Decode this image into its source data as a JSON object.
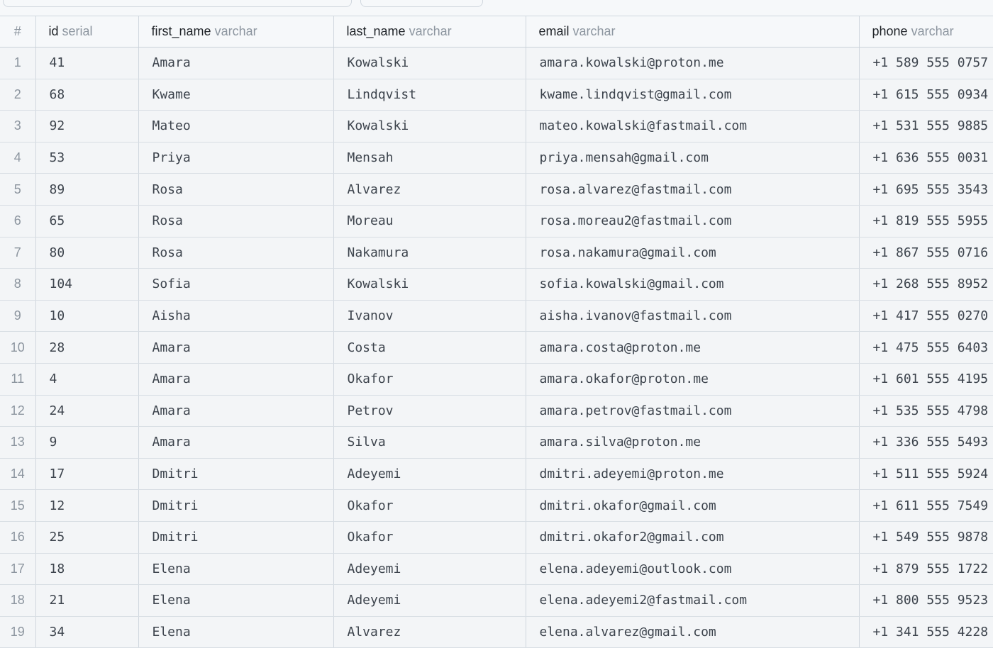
{
  "columns": [
    {
      "name": "id",
      "type": "serial"
    },
    {
      "name": "first_name",
      "type": "varchar"
    },
    {
      "name": "last_name",
      "type": "varchar"
    },
    {
      "name": "email",
      "type": "varchar"
    },
    {
      "name": "phone",
      "type": "varchar"
    }
  ],
  "rownum_header": "#",
  "rows": [
    {
      "n": "1",
      "cells": [
        "41",
        "Amara",
        "Kowalski",
        "amara.kowalski@proton.me",
        "+1 589 555 0757"
      ]
    },
    {
      "n": "2",
      "cells": [
        "68",
        "Kwame",
        "Lindqvist",
        "kwame.lindqvist@gmail.com",
        "+1 615 555 0934"
      ]
    },
    {
      "n": "3",
      "cells": [
        "92",
        "Mateo",
        "Kowalski",
        "mateo.kowalski@fastmail.com",
        "+1 531 555 9885"
      ]
    },
    {
      "n": "4",
      "cells": [
        "53",
        "Priya",
        "Mensah",
        "priya.mensah@gmail.com",
        "+1 636 555 0031"
      ]
    },
    {
      "n": "5",
      "cells": [
        "89",
        "Rosa",
        "Alvarez",
        "rosa.alvarez@fastmail.com",
        "+1 695 555 3543"
      ]
    },
    {
      "n": "6",
      "cells": [
        "65",
        "Rosa",
        "Moreau",
        "rosa.moreau2@fastmail.com",
        "+1 819 555 5955"
      ]
    },
    {
      "n": "7",
      "cells": [
        "80",
        "Rosa",
        "Nakamura",
        "rosa.nakamura@gmail.com",
        "+1 867 555 0716"
      ]
    },
    {
      "n": "8",
      "cells": [
        "104",
        "Sofia",
        "Kowalski",
        "sofia.kowalski@gmail.com",
        "+1 268 555 8952"
      ]
    },
    {
      "n": "9",
      "cells": [
        "10",
        "Aisha",
        "Ivanov",
        "aisha.ivanov@fastmail.com",
        "+1 417 555 0270"
      ]
    },
    {
      "n": "10",
      "cells": [
        "28",
        "Amara",
        "Costa",
        "amara.costa@proton.me",
        "+1 475 555 6403"
      ]
    },
    {
      "n": "11",
      "cells": [
        "4",
        "Amara",
        "Okafor",
        "amara.okafor@proton.me",
        "+1 601 555 4195"
      ]
    },
    {
      "n": "12",
      "cells": [
        "24",
        "Amara",
        "Petrov",
        "amara.petrov@fastmail.com",
        "+1 535 555 4798"
      ]
    },
    {
      "n": "13",
      "cells": [
        "9",
        "Amara",
        "Silva",
        "amara.silva@proton.me",
        "+1 336 555 5493"
      ]
    },
    {
      "n": "14",
      "cells": [
        "17",
        "Dmitri",
        "Adeyemi",
        "dmitri.adeyemi@proton.me",
        "+1 511 555 5924"
      ]
    },
    {
      "n": "15",
      "cells": [
        "12",
        "Dmitri",
        "Okafor",
        "dmitri.okafor@gmail.com",
        "+1 611 555 7549"
      ]
    },
    {
      "n": "16",
      "cells": [
        "25",
        "Dmitri",
        "Okafor",
        "dmitri.okafor2@gmail.com",
        "+1 549 555 9878"
      ]
    },
    {
      "n": "17",
      "cells": [
        "18",
        "Elena",
        "Adeyemi",
        "elena.adeyemi@outlook.com",
        "+1 879 555 1722"
      ]
    },
    {
      "n": "18",
      "cells": [
        "21",
        "Elena",
        "Adeyemi",
        "elena.adeyemi2@fastmail.com",
        "+1 800 555 9523"
      ]
    },
    {
      "n": "19",
      "cells": [
        "34",
        "Elena",
        "Alvarez",
        "elena.alvarez@gmail.com",
        "+1 341 555 4228"
      ]
    }
  ]
}
